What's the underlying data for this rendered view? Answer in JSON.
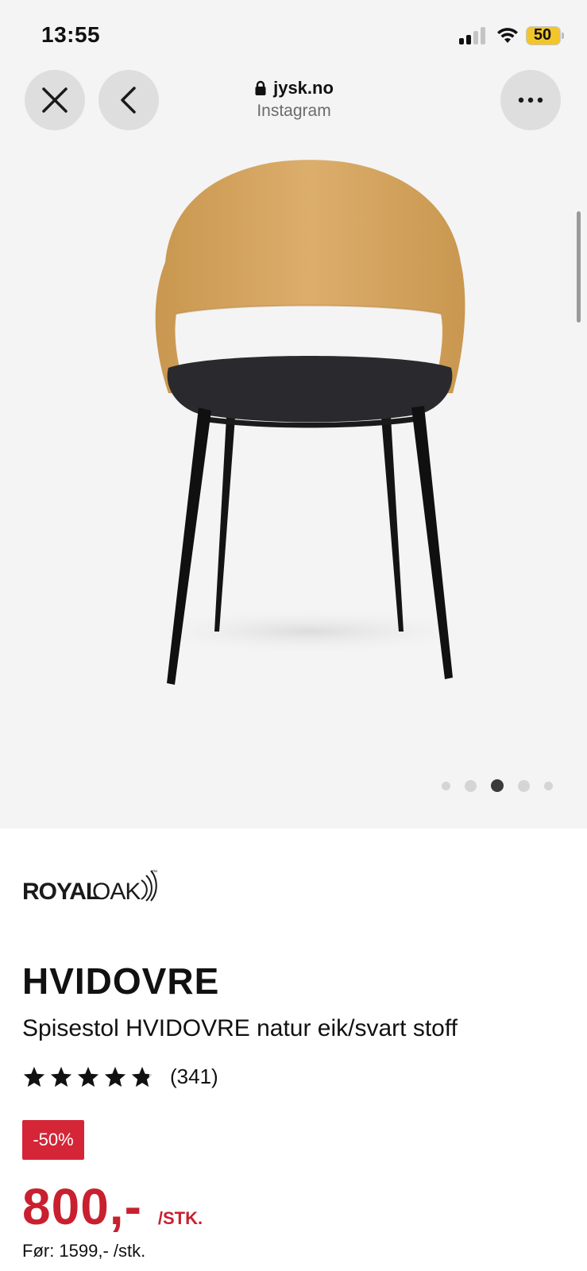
{
  "status_bar": {
    "time": "13:55",
    "battery": "50"
  },
  "browser": {
    "url": "jysk.no",
    "source": "Instagram",
    "icons": [
      "close-icon",
      "chevron-left-icon",
      "lock-icon",
      "more-icon"
    ]
  },
  "gallery": {
    "image": "chair-photo",
    "dot_count": 5,
    "active_dot": 3
  },
  "product": {
    "brand": "ROYALOAK",
    "brand_parts": [
      "ROYAL",
      "OAK"
    ],
    "brand_tm": "™",
    "name": "HVIDOVRE",
    "description": "Spisestol HVIDOVRE natur eik/svart stoff",
    "rating": 4.8,
    "review_count": "(341)",
    "discount": "-50%",
    "price": "800,-",
    "price_unit": "/STK.",
    "old_price": "Før: 1599,- /stk."
  },
  "colors": {
    "price_red": "#c8202f",
    "badge_red": "#d42637",
    "gallery_bg": "#f4f4f4",
    "oak": "#d6a868"
  }
}
